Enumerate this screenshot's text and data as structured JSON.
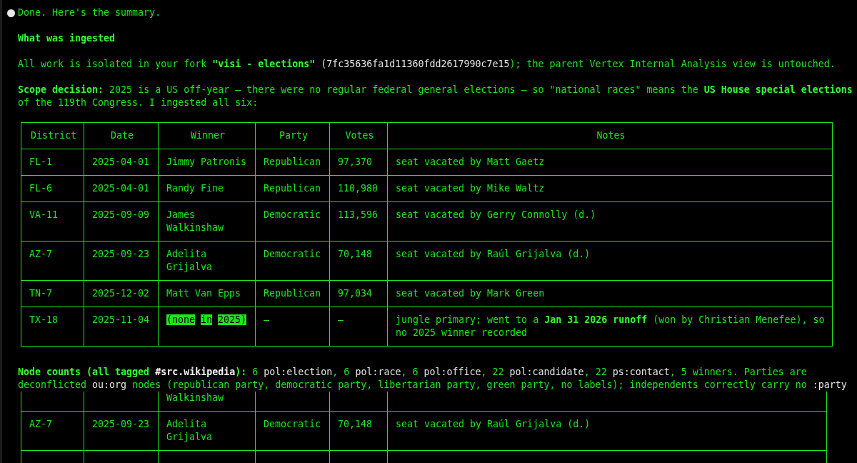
{
  "message": {
    "status_line": "Done. Here's the summary.",
    "heading": "What was ingested",
    "paragraphs": [
      [
        {
          "text": "All work is isolated in your fork ",
          "kind": "plain"
        },
        {
          "text": "\"visi - elections\"",
          "kind": "strong"
        },
        {
          "text": " (7fc35636fa1d11360fdd2617990c7e15",
          "kind": "code"
        },
        {
          "text": "); the parent Vertex Internal Analysis view is untouched.",
          "kind": "plain"
        }
      ],
      [
        {
          "text": "Scope decision:",
          "kind": "strong"
        },
        {
          "text": " 2025 is a US off-year — there were no regular federal general elections — so \"national races\" means the ",
          "kind": "plain"
        },
        {
          "text": "US House special elections",
          "kind": "strong"
        },
        {
          "text": " of the 119th Congress. I ingested all six:",
          "kind": "plain"
        }
      ]
    ],
    "table": {
      "columns": [
        "District",
        "Date",
        "Winner",
        "Party",
        "Votes",
        "Notes"
      ],
      "rows": [
        {
          "district": "FL-1",
          "date": "2025-04-01",
          "winner": "Jimmy Patronis",
          "highlighted": false,
          "party": "Republican",
          "votes": "97,370",
          "notes": "seat vacated by Matt Gaetz"
        },
        {
          "district": "FL-6",
          "date": "2025-04-01",
          "winner": "Randy Fine",
          "highlighted": false,
          "party": "Republican",
          "votes": "110,980",
          "notes": "seat vacated by Mike Waltz"
        },
        {
          "district": "VA-11",
          "date": "2025-09-09",
          "winner": "James Walkinshaw",
          "highlighted": false,
          "party": "Democratic",
          "votes": "113,596",
          "notes": "seat vacated by Gerry Connolly (d.)"
        },
        {
          "district": "AZ-7",
          "date": "2025-09-23",
          "winner": "Adelita Grijalva",
          "highlighted": false,
          "party": "Democratic",
          "votes": "70,148",
          "notes": "seat vacated by Raúl Grijalva (d.)"
        },
        {
          "district": "TN-7",
          "date": "2025-12-02",
          "winner": "Matt Van Epps",
          "highlighted": false,
          "party": "Republican",
          "votes": "97,034",
          "notes": "seat vacated by Mark Green"
        },
        {
          "district": "TX-18",
          "date": "2025-11-04",
          "winner": "(none in 2025)",
          "highlighted": true,
          "party": "—",
          "votes": "—",
          "notes": "jungle primary; went to a **Jan 31 2026 runoff** (won by Christian Menefee), so no 2025 winner recorded"
        }
      ]
    },
    "node_counts": [
      {
        "text": "Node counts (all tagged ",
        "kind": "strong"
      },
      {
        "text": "#src.wikipedia",
        "kind": "strong-code"
      },
      {
        "text": "):",
        "kind": "strong"
      },
      {
        "text": " 6 ",
        "kind": "plain"
      },
      {
        "text": "pol:election",
        "kind": "code"
      },
      {
        "text": ", 6 ",
        "kind": "plain"
      },
      {
        "text": "pol:race",
        "kind": "code"
      },
      {
        "text": ", 6 ",
        "kind": "plain"
      },
      {
        "text": "pol:office",
        "kind": "code"
      },
      {
        "text": ", 22 ",
        "kind": "plain"
      },
      {
        "text": "pol:candidate",
        "kind": "code"
      },
      {
        "text": ", 22 ",
        "kind": "plain"
      },
      {
        "text": "ps:contact",
        "kind": "code"
      },
      {
        "text": ", 5 winners. Parties are deconflicted ",
        "kind": "plain"
      },
      {
        "text": "ou:org",
        "kind": "code"
      },
      {
        "text": " nodes (republican party, democratic party, libertarian party, green party, no labels); independents correctly carry no ",
        "kind": "plain"
      },
      {
        "text": ":party",
        "kind": "code"
      }
    ],
    "overlapping_fragment": {
      "rows": [
        {
          "kind": "continuation",
          "winner": "Walkinshaw"
        },
        {
          "kind": "row",
          "district": "AZ-7",
          "date": "2025-09-23",
          "winner": "Adelita Grijalva",
          "party": "Democratic",
          "votes": "70,148",
          "notes": "seat vacated by Raúl Grijalva (d.)"
        },
        {
          "kind": "cut"
        }
      ]
    }
  }
}
